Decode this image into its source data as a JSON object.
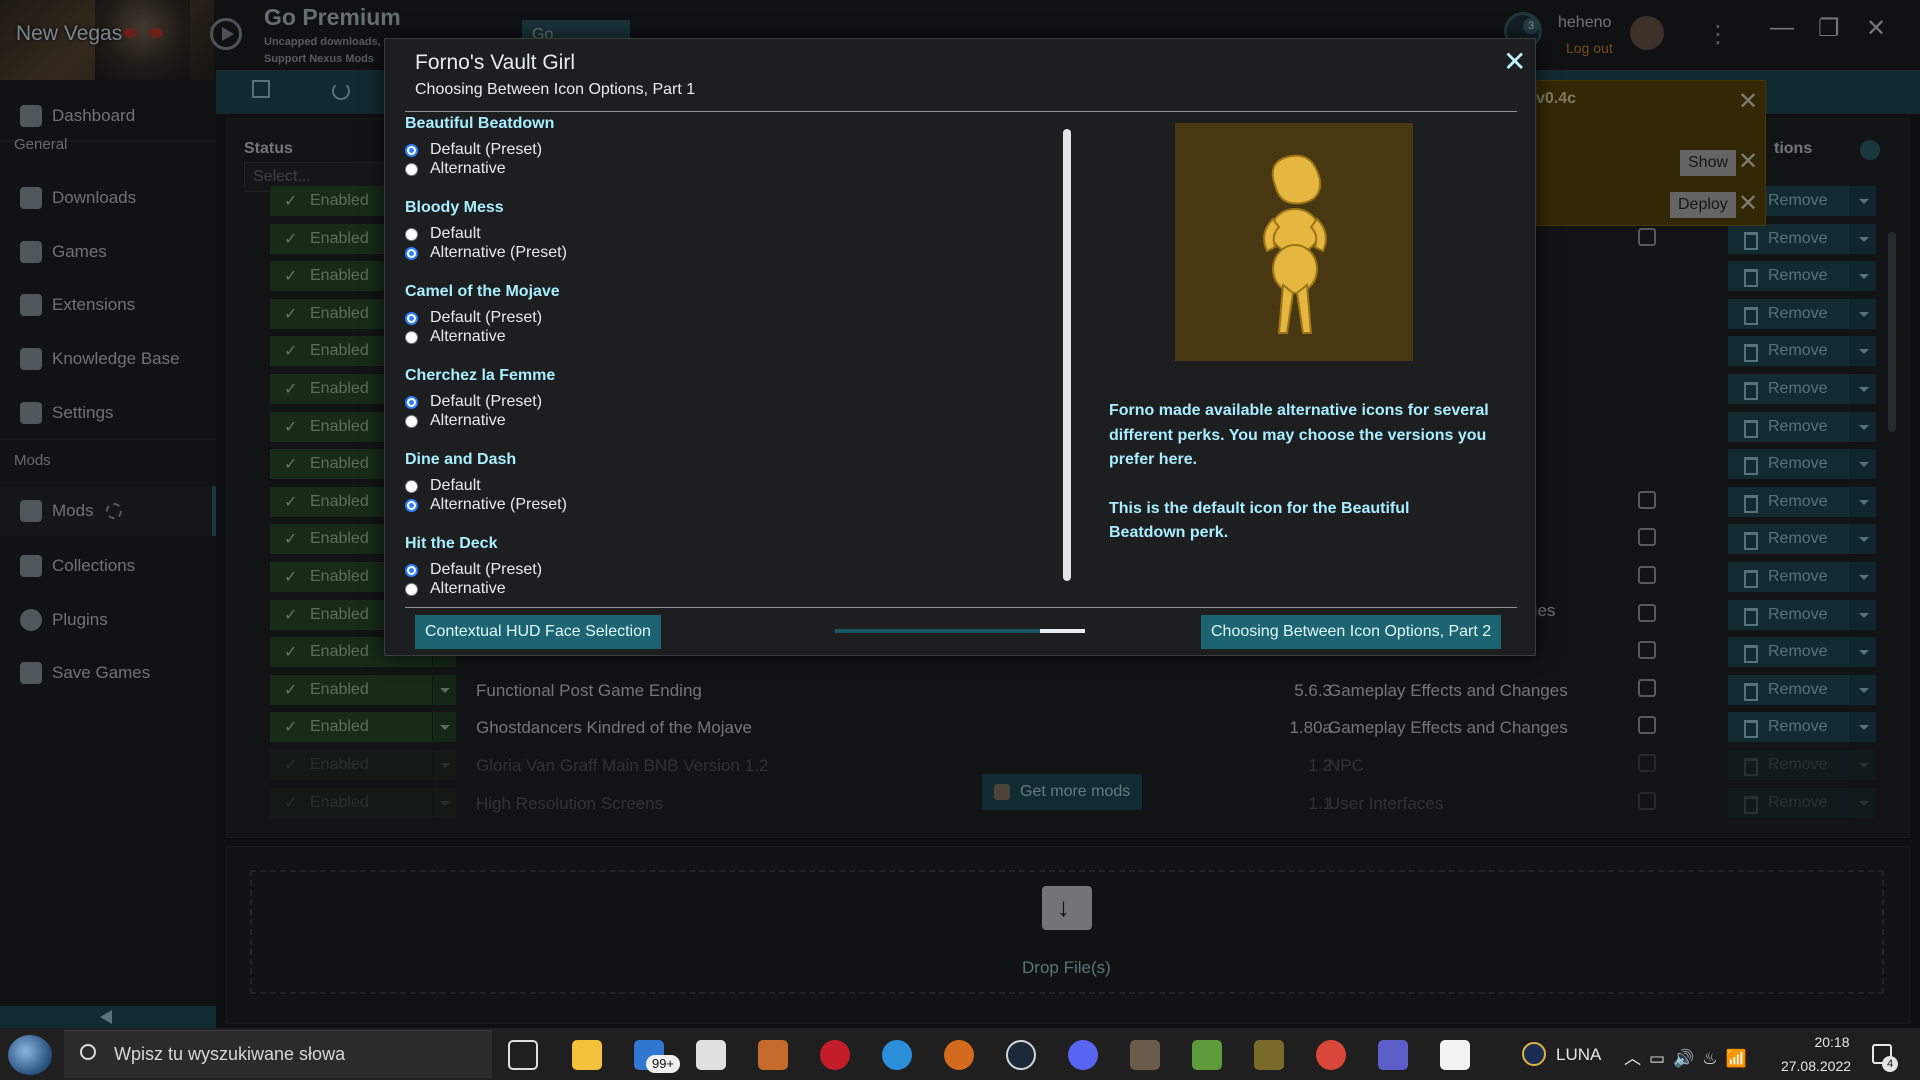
{
  "app": {
    "game_title": "New Vegas",
    "premium": {
      "title": "Go Premium",
      "line1": "Uncapped downloads,",
      "line2": "Support Nexus Mods",
      "button": "Go Premium"
    },
    "user": {
      "name": "heheno",
      "logout": "Log out",
      "notification_count": "3"
    }
  },
  "sidebar": {
    "top": [
      {
        "label": "Dashboard",
        "icon": "dashboard-icon"
      }
    ],
    "general_heading": "General",
    "general": [
      {
        "label": "Downloads",
        "icon": "download-icon"
      },
      {
        "label": "Games",
        "icon": "gamepad-icon"
      },
      {
        "label": "Extensions",
        "icon": "extensions-icon"
      },
      {
        "label": "Knowledge Base",
        "icon": "info-icon"
      },
      {
        "label": "Settings",
        "icon": "gear-icon"
      }
    ],
    "mods_heading": "Mods",
    "mods": [
      {
        "label": "Mods",
        "icon": "wrench-icon"
      },
      {
        "label": "Collections",
        "icon": "layers-icon"
      },
      {
        "label": "Plugins",
        "icon": "plus-circle-icon"
      },
      {
        "label": "Save Games",
        "icon": "save-icon"
      }
    ]
  },
  "mods_table": {
    "status_label": "Status",
    "status_placeholder": "Select...",
    "actions_label": "tions",
    "rows": [
      {
        "state": "Enabled",
        "name": "Functional Post Game Ending",
        "version": "5.6.3",
        "category": "Gameplay Effects and Changes",
        "action": "Remove"
      },
      {
        "state": "Enabled",
        "name": "Ghostdancers Kindred of the Mojave",
        "version": "1.80a",
        "category": "Gameplay Effects and Changes",
        "action": "Remove"
      },
      {
        "state": "Enabled",
        "name": "Gloria Van Graff Main BNB Version 1.2",
        "version": "1.2",
        "category": "NPC",
        "action": "Remove"
      },
      {
        "state": "Enabled",
        "name": "High Resolution Screens",
        "version": "1.1",
        "category": "User Interfaces",
        "action": "Remove"
      }
    ],
    "partial_category": "ges",
    "enabled_label": "Enabled",
    "remove_label": "Remove",
    "get_more": "Get more mods"
  },
  "drop_zone": {
    "label": "Drop File(s)"
  },
  "notifications": {
    "title": "v0.4c",
    "show": "Show",
    "deploy": "Deploy"
  },
  "dialog": {
    "title": "Forno's Vault Girl",
    "subtitle": "Choosing Between Icon Options, Part 1",
    "groups": [
      {
        "title": "Beautiful Beatdown",
        "options": [
          {
            "label": "Default (Preset)",
            "checked": true
          },
          {
            "label": "Alternative",
            "checked": false
          }
        ]
      },
      {
        "title": "Bloody Mess",
        "options": [
          {
            "label": "Default",
            "checked": false
          },
          {
            "label": "Alternative (Preset)",
            "checked": true
          }
        ]
      },
      {
        "title": "Camel of the Mojave",
        "options": [
          {
            "label": "Default (Preset)",
            "checked": true
          },
          {
            "label": "Alternative",
            "checked": false
          }
        ]
      },
      {
        "title": "Cherchez la Femme",
        "options": [
          {
            "label": "Default (Preset)",
            "checked": true
          },
          {
            "label": "Alternative",
            "checked": false
          }
        ]
      },
      {
        "title": "Dine and Dash",
        "options": [
          {
            "label": "Default",
            "checked": false
          },
          {
            "label": "Alternative (Preset)",
            "checked": true
          }
        ]
      },
      {
        "title": "Hit the Deck",
        "options": [
          {
            "label": "Default (Preset)",
            "checked": true
          },
          {
            "label": "Alternative",
            "checked": false
          }
        ]
      }
    ],
    "description_1": "Forno made available alternative icons for several different perks.  You may choose the versions you prefer here.",
    "description_2": "This is the default icon for the Beautiful Beatdown perk.",
    "prev_button": "Contextual HUD Face Selection",
    "next_button": "Choosing Between Icon Options, Part 2",
    "progress": 0.82
  },
  "taskbar": {
    "search_placeholder": "Wpisz tu wyszukiwane słowa",
    "mail_badge": "99+",
    "weather_label": "LUNA",
    "time": "20:18",
    "date": "27.08.2022",
    "notification_count": "4"
  },
  "colors": {
    "accent": "#1c6472",
    "option_title": "#a8eefe",
    "enabled": "#2b4f2c",
    "notification": "#5b4a0b"
  }
}
